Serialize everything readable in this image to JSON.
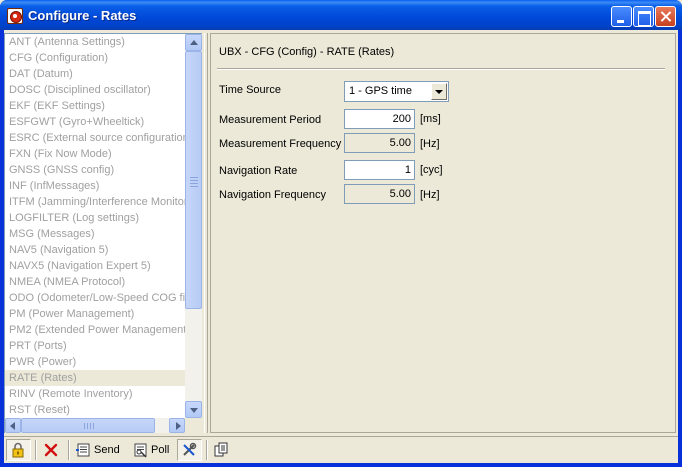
{
  "window": {
    "title": "Configure - Rates"
  },
  "sidebar": {
    "items": [
      "ANT (Antenna Settings)",
      "CFG (Configuration)",
      "DAT (Datum)",
      "DOSC (Disciplined oscillator)",
      "EKF (EKF Settings)",
      "ESFGWT (Gyro+Wheeltick)",
      "ESRC (External source configuration",
      "FXN (Fix Now Mode)",
      "GNSS (GNSS config)",
      "INF (InfMessages)",
      "ITFM (Jamming/Interference Monitor",
      "LOGFILTER (Log settings)",
      "MSG (Messages)",
      "NAV5 (Navigation 5)",
      "NAVX5 (Navigation Expert 5)",
      "NMEA (NMEA Protocol)",
      "ODO (Odometer/Low-Speed COG filt",
      "PM (Power Management)",
      "PM2 (Extended Power Management)",
      "PRT (Ports)",
      "PWR (Power)",
      "RATE (Rates)",
      "RINV (Remote Inventory)",
      "RST (Reset)"
    ],
    "selected_index": 21,
    "hscroll_grip": "|||"
  },
  "panel": {
    "title": "UBX - CFG (Config) - RATE (Rates)",
    "time_source": {
      "label": "Time Source",
      "value": "1 - GPS time"
    },
    "measurement_period": {
      "label": "Measurement Period",
      "value": "200",
      "unit": "[ms]"
    },
    "measurement_frequency": {
      "label": "Measurement Frequency",
      "value": "5.00",
      "unit": "[Hz]"
    },
    "navigation_rate": {
      "label": "Navigation Rate",
      "value": "1",
      "unit": "[cyc]"
    },
    "navigation_frequency": {
      "label": "Navigation Frequency",
      "value": "5.00",
      "unit": "[Hz]"
    }
  },
  "toolbar": {
    "send_label": "Send",
    "poll_label": "Poll"
  },
  "colors": {
    "titlebar": "#0054e3",
    "disabled_text": "#a0a0a0",
    "face": "#ece9d8"
  }
}
